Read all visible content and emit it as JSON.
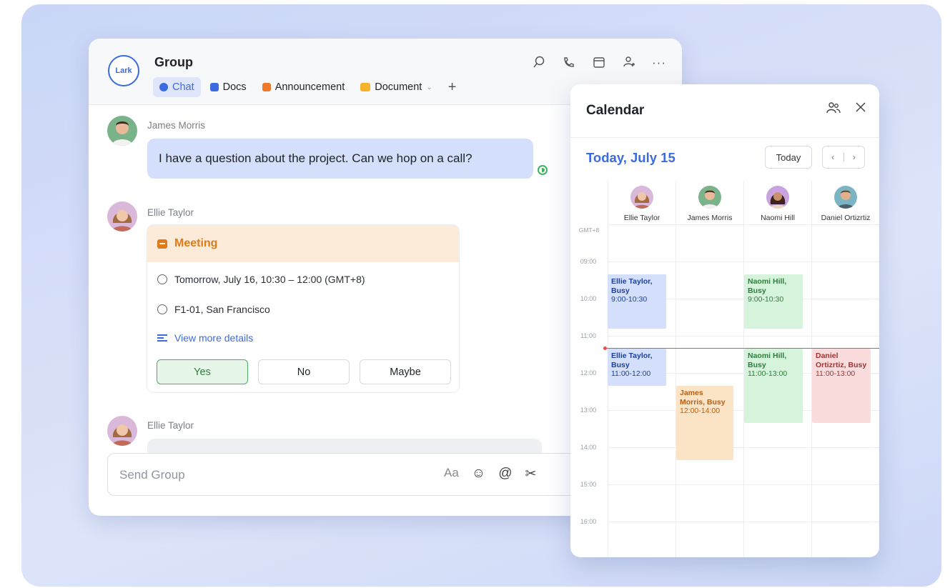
{
  "chat": {
    "logo_text": "Lark",
    "title": "Group",
    "tabs": [
      {
        "label": "Chat",
        "color": "#3c6be0"
      },
      {
        "label": "Docs",
        "color": "#3c6be0"
      },
      {
        "label": "Announcement",
        "color": "#f0782c"
      },
      {
        "label": "Document",
        "color": "#f5b32a"
      }
    ],
    "add_tab": "+",
    "header_icons": [
      "search-icon",
      "call-icon",
      "calendar-icon",
      "add-member-icon",
      "more-icon"
    ],
    "messages": [
      {
        "sender": "James Morris",
        "text": "I have a question about the project. Can we hop on a call?"
      },
      {
        "sender": "Ellie Taylor"
      },
      {
        "sender": "Ellie Taylor"
      }
    ],
    "meeting_card": {
      "title": "Meeting",
      "time": "Tomorrow, July 16, 10:30 – 12:00 (GMT+8)",
      "location": "F1-01, San Francisco",
      "details_link": "View more details",
      "buttons": {
        "yes": "Yes",
        "no": "No",
        "maybe": "Maybe"
      }
    },
    "composer": {
      "placeholder": "Send Group",
      "tools": [
        "Aa",
        "☺",
        "@",
        "✂"
      ]
    }
  },
  "calendar": {
    "title": "Calendar",
    "today_label": "Today, July 15",
    "today_button": "Today",
    "nav_prev": "‹",
    "nav_next": "›",
    "timezone": "GMT+8",
    "people": [
      "Ellie Taylor",
      "James Morris",
      "Naomi Hill",
      "Daniel Ortizrtiz"
    ],
    "times": [
      "09:00",
      "10:00",
      "11:00",
      "12:00",
      "13:00",
      "14:00",
      "15:00",
      "16:00"
    ],
    "events": [
      {
        "name": "Ellie Taylor, Busy",
        "time": "9:00-10:30",
        "color": "blue"
      },
      {
        "name": "Naomi Hill, Busy",
        "time": "9:00-10:30",
        "color": "green"
      },
      {
        "name": "Ellie Taylor, Busy",
        "time": "11:00-12:00",
        "color": "blue"
      },
      {
        "name": "Naomi Hill, Busy",
        "time": "11:00-13:00",
        "color": "green"
      },
      {
        "name": "Daniel Ortizrtiz, Busy",
        "time": "11:00-13:00",
        "color": "red"
      },
      {
        "name": "James Morris, Busy",
        "time": "12:00-14:00",
        "color": "orange"
      }
    ]
  }
}
